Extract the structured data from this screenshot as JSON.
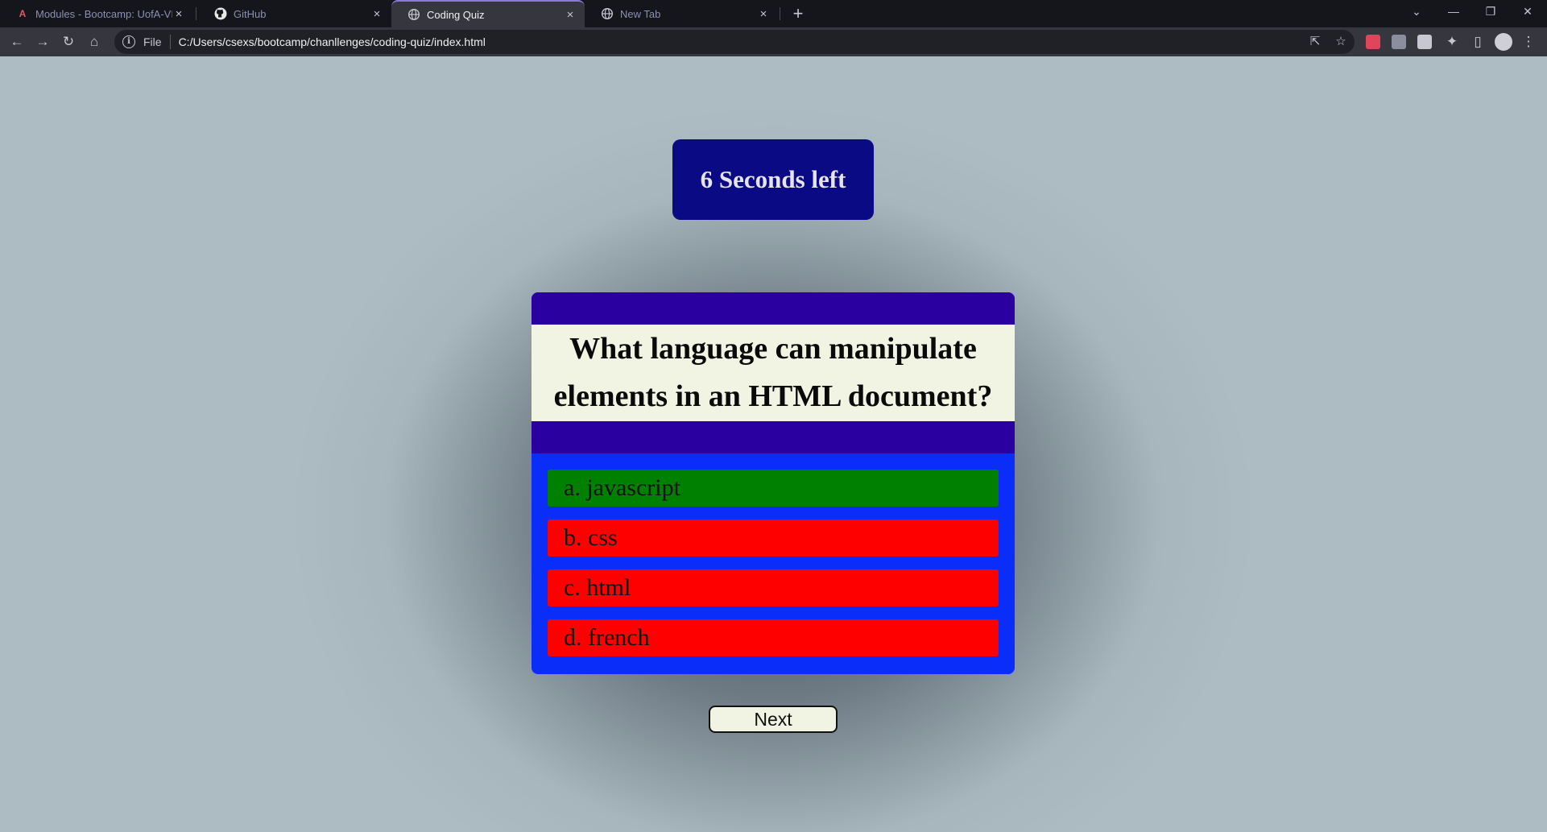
{
  "browser": {
    "tabs": [
      {
        "title": "Modules - Bootcamp: UofA-VIRT",
        "favicon": "university-icon"
      },
      {
        "title": "GitHub",
        "favicon": "github-icon"
      },
      {
        "title": "Coding Quiz",
        "favicon": "globe-icon",
        "active": true
      },
      {
        "title": "New Tab",
        "favicon": "globe-icon"
      }
    ],
    "address": {
      "scheme_label": "File",
      "url": "C:/Users/csexs/bootcamp/chanllenges/coding-quiz/index.html"
    }
  },
  "quiz": {
    "timer_text": "6 Seconds left",
    "question_line1": "What language can manipulate",
    "question_line2": "elements in an HTML document?",
    "answers": [
      {
        "label": "a. javascript",
        "status": "correct"
      },
      {
        "label": "b. css",
        "status": "wrong"
      },
      {
        "label": "c. html",
        "status": "wrong"
      },
      {
        "label": "d. french",
        "status": "wrong"
      }
    ],
    "next_label": "Next"
  },
  "colors": {
    "timer_bg": "#0b0a85",
    "card_bg": "#0a2dfa",
    "card_band": "#2a00a0",
    "question_bg": "#f1f3e3",
    "correct": "#008000",
    "wrong": "#ff0000"
  }
}
